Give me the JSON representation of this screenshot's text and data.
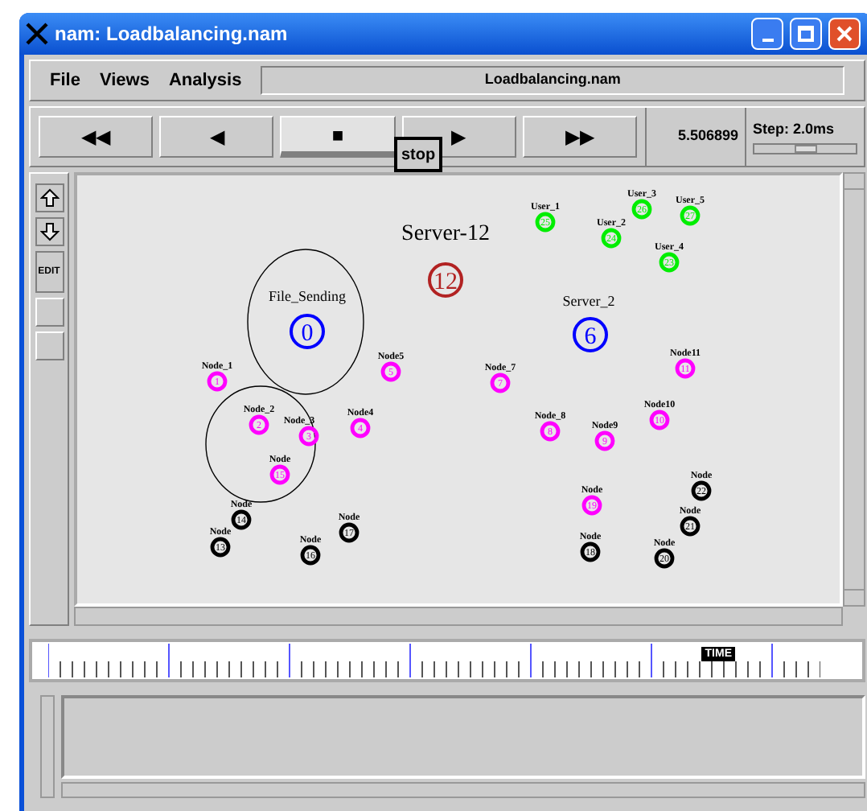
{
  "window": {
    "title": "nam: Loadbalancing.nam"
  },
  "menu": [
    {
      "label": "File"
    },
    {
      "label": "Views"
    },
    {
      "label": "Analysis"
    }
  ],
  "file_field": {
    "value": "Loadbalancing.nam"
  },
  "controls": [
    {
      "glyph": "◀◀",
      "selected": false
    },
    {
      "glyph": "◀",
      "selected": false
    },
    {
      "glyph": "■",
      "selected": true
    },
    {
      "glyph": "▶",
      "selected": false
    },
    {
      "glyph": "▶▶",
      "selected": false
    }
  ],
  "tooltip": "stop",
  "time": "5.506899",
  "step": {
    "label": "Step: 2.0ms",
    "level": 0.5
  },
  "tools": [
    {
      "kind": "icon"
    },
    {
      "kind": "icon"
    },
    {
      "kind": "text",
      "label": "EDIT"
    },
    {
      "kind": "blank"
    },
    {
      "kind": "blank"
    }
  ],
  "titles": [
    {
      "text": "Server-12"
    },
    {
      "text": "File_Sending"
    },
    {
      "text": "Server_2"
    }
  ],
  "nodes": [
    {
      "number": "12",
      "color": "#b22222",
      "kind": "server"
    },
    {
      "number": "0",
      "color": "#0000ff",
      "kind": "server"
    },
    {
      "number": "6",
      "color": "#0000ff",
      "kind": "server"
    },
    {
      "label": "Node_1",
      "number": "1",
      "color": "#ff00ff",
      "kind": "node"
    },
    {
      "label": "Node_2",
      "number": "2",
      "color": "#ff00ff",
      "kind": "node"
    },
    {
      "label": "Node_3",
      "number": "3",
      "color": "#ff00ff",
      "kind": "node"
    },
    {
      "label": "Node4",
      "number": "4",
      "color": "#ff00ff",
      "kind": "node"
    },
    {
      "label": "Node5",
      "number": "5",
      "color": "#ff00ff",
      "kind": "node"
    },
    {
      "label": "Node",
      "number": "15",
      "color": "#ff00ff",
      "kind": "node"
    },
    {
      "label": "Node",
      "number": "14",
      "color": "#000000",
      "kind": "node"
    },
    {
      "label": "Node",
      "number": "13",
      "color": "#000000",
      "kind": "node"
    },
    {
      "label": "Node",
      "number": "16",
      "color": "#000000",
      "kind": "node"
    },
    {
      "label": "Node",
      "number": "17",
      "color": "#000000",
      "kind": "node"
    },
    {
      "label": "Node_7",
      "number": "7",
      "color": "#ff00ff",
      "kind": "node"
    },
    {
      "label": "Node_8",
      "number": "8",
      "color": "#ff00ff",
      "kind": "node"
    },
    {
      "label": "Node9",
      "number": "9",
      "color": "#ff00ff",
      "kind": "node"
    },
    {
      "label": "Node10",
      "number": "10",
      "color": "#ff00ff",
      "kind": "node"
    },
    {
      "label": "Node11",
      "number": "11",
      "color": "#ff00ff",
      "kind": "node"
    },
    {
      "label": "Node",
      "number": "19",
      "color": "#ff00ff",
      "kind": "node"
    },
    {
      "label": "Node",
      "number": "18",
      "color": "#000000",
      "kind": "node"
    },
    {
      "label": "Node",
      "number": "22",
      "color": "#000000",
      "kind": "node"
    },
    {
      "label": "Node",
      "number": "21",
      "color": "#000000",
      "kind": "node"
    },
    {
      "label": "Node",
      "number": "20",
      "color": "#000000",
      "kind": "node"
    },
    {
      "label": "User_1",
      "number": "25",
      "color": "#00ee00",
      "kind": "node"
    },
    {
      "label": "User_2",
      "number": "24",
      "color": "#00ee00",
      "kind": "node"
    },
    {
      "label": "User_3",
      "number": "26",
      "color": "#00ee00",
      "kind": "node"
    },
    {
      "label": "User_5",
      "number": "27",
      "color": "#00ee00",
      "kind": "node"
    },
    {
      "label": "User_4",
      "number": "23",
      "color": "#00ee00",
      "kind": "node"
    }
  ],
  "timeline": {
    "label": "TIME",
    "level": 0.83
  }
}
